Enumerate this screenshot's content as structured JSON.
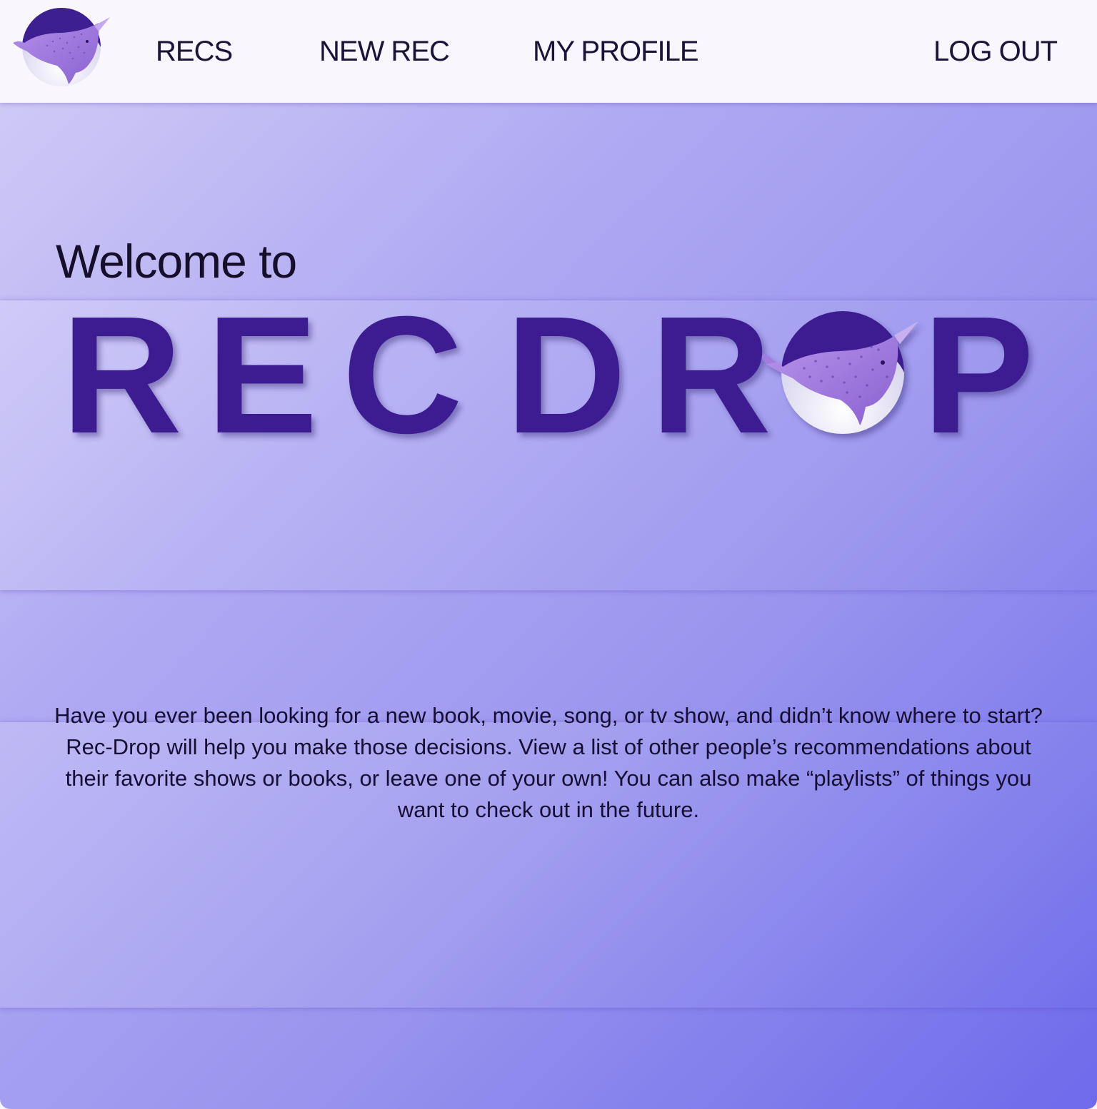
{
  "nav": {
    "links": [
      {
        "label": "RECS"
      },
      {
        "label": "NEW REC"
      },
      {
        "label": "MY PROFILE"
      }
    ],
    "logout_label": "LOG OUT",
    "logo_icon": "narwhal-logo-icon"
  },
  "hero": {
    "welcome": "Welcome to",
    "brand_left": "REC",
    "brand_right_a": "DR",
    "brand_right_b": "P",
    "brand_logo_icon": "narwhal-logo-icon"
  },
  "about": {
    "text": "Have you ever been looking for a new book, movie, song, or tv show, and didn’t know where to start? Rec-Drop will help you make those decisions. View a list of other people’s recommendations about their favorite shows or books, or leave one of your own! You can also make “playlists” of things you want to check out in the future."
  },
  "colors": {
    "brand": "#3d1f91",
    "nav_bg": "#f9f6fd",
    "text": "#160f33",
    "gradient_start": "#cfc9f6",
    "gradient_end": "#6e6aeb"
  }
}
